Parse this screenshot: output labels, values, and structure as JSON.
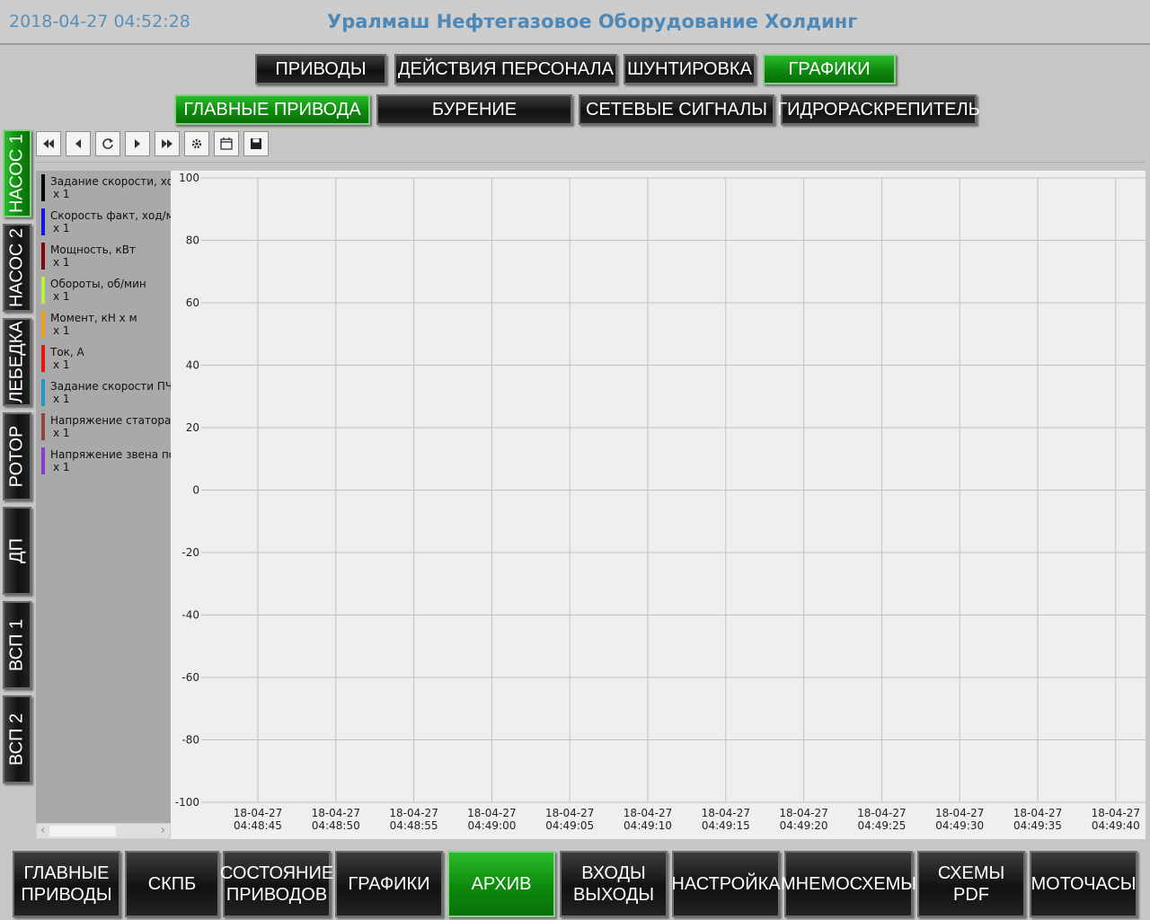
{
  "header": {
    "datetime": "2018-04-27 04:52:28",
    "company": "Уралмаш Нефтегазовое Оборудование Холдинг"
  },
  "top_nav": [
    {
      "label": "ПРИВОДЫ",
      "active": false
    },
    {
      "label": "ДЕЙСТВИЯ ПЕРСОНАЛА",
      "active": false
    },
    {
      "label": "ШУНТИРОВКА",
      "active": false
    },
    {
      "label": "ГРАФИКИ",
      "active": true
    }
  ],
  "sub_nav": [
    {
      "label": "ГЛАВНЫЕ ПРИВОДА",
      "active": true
    },
    {
      "label": "БУРЕНИЕ",
      "active": false
    },
    {
      "label": "СЕТЕВЫЕ СИГНАЛЫ",
      "active": false
    },
    {
      "label": "ГИДРОРАСКРЕПИТЕЛЬ",
      "active": false
    }
  ],
  "side_tabs": [
    {
      "label": "НАСОС 1",
      "active": true
    },
    {
      "label": "НАСОС 2",
      "active": false
    },
    {
      "label": "ЛЕБЕДКА",
      "active": false
    },
    {
      "label": "РОТОР",
      "active": false
    },
    {
      "label": "ДП",
      "active": false
    },
    {
      "label": "ВСП 1",
      "active": false
    },
    {
      "label": "ВСП 2",
      "active": false
    }
  ],
  "toolbar": [
    {
      "icon": "rewind-icon",
      "glyph": "◀◀"
    },
    {
      "icon": "step-back-icon",
      "glyph": "◀"
    },
    {
      "icon": "refresh-icon",
      "glyph": "↻"
    },
    {
      "icon": "step-forward-icon",
      "glyph": "▶"
    },
    {
      "icon": "fast-forward-icon",
      "glyph": "▶▶"
    },
    {
      "icon": "settings-icon",
      "glyph": "⚙"
    },
    {
      "icon": "calendar-icon",
      "glyph": "▦"
    },
    {
      "icon": "save-icon",
      "glyph": "▪"
    }
  ],
  "legend": [
    {
      "name": "Задание скорости, ход/мин",
      "scale": "x 1",
      "color": "#000000"
    },
    {
      "name": "Скорость факт, ход/мин",
      "scale": "x 1",
      "color": "#1414e6"
    },
    {
      "name": "Мощность, кВт",
      "scale": "x 1",
      "color": "#7a0a0a"
    },
    {
      "name": "Обороты, об/мин",
      "scale": "x 1",
      "color": "#b4f03c"
    },
    {
      "name": "Момент, кН х м",
      "scale": "x 1",
      "color": "#f0a020"
    },
    {
      "name": "Ток, А",
      "scale": "x 1",
      "color": "#ee1111"
    },
    {
      "name": "Задание скорости ПЧ, об/мин",
      "scale": "x 1",
      "color": "#1c9cc0"
    },
    {
      "name": "Напряжение статора, В",
      "scale": "x 1",
      "color": "#8a4a3c"
    },
    {
      "name": "Напряжение звена постоянного тока, В",
      "scale": "x 1",
      "color": "#8a3cc8"
    }
  ],
  "chart_data": {
    "type": "line",
    "series": [],
    "y_ticks": [
      "100",
      "80",
      "60",
      "40",
      "20",
      "0",
      "-20",
      "-40",
      "-60",
      "-80",
      "-100"
    ],
    "ylim": [
      -100,
      100
    ],
    "x_ticks": [
      [
        "18-04-27",
        "04:48:45"
      ],
      [
        "18-04-27",
        "04:48:50"
      ],
      [
        "18-04-27",
        "04:48:55"
      ],
      [
        "18-04-27",
        "04:49:00"
      ],
      [
        "18-04-27",
        "04:49:05"
      ],
      [
        "18-04-27",
        "04:49:10"
      ],
      [
        "18-04-27",
        "04:49:15"
      ],
      [
        "18-04-27",
        "04:49:20"
      ],
      [
        "18-04-27",
        "04:49:25"
      ],
      [
        "18-04-27",
        "04:49:30"
      ],
      [
        "18-04-27",
        "04:49:35"
      ],
      [
        "18-04-27",
        "04:49:40"
      ]
    ],
    "grid": true
  },
  "bottom_nav": [
    {
      "label": "ГЛАВНЫЕ ПРИВОДЫ",
      "active": false
    },
    {
      "label": "СКПБ",
      "active": false
    },
    {
      "label": "СОСТОЯНИЕ ПРИВОДОВ",
      "active": false
    },
    {
      "label": "ГРАФИКИ",
      "active": false
    },
    {
      "label": "АРХИВ",
      "active": true
    },
    {
      "label": "ВХОДЫ ВЫХОДЫ",
      "active": false
    },
    {
      "label": "НАСТРОЙКА",
      "active": false
    },
    {
      "label": "МНЕМОСХЕМЫ",
      "active": false
    },
    {
      "label": "СХЕМЫ PDF",
      "active": false
    },
    {
      "label": "МОТОЧАСЫ",
      "active": false
    }
  ]
}
